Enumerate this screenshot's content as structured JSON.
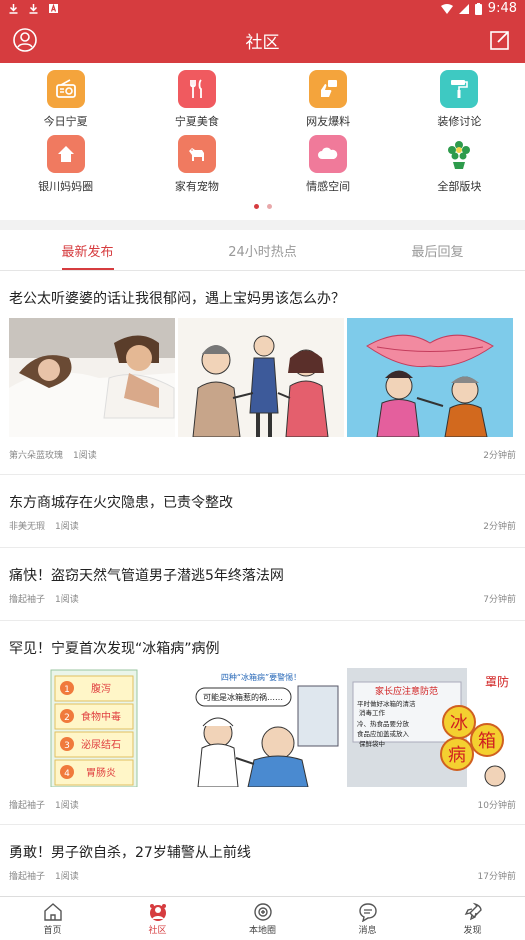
{
  "status": {
    "time": "9:48"
  },
  "header": {
    "title": "社区"
  },
  "categories": [
    {
      "label": "今日宁夏",
      "icon": "radio-icon",
      "color": "#f4a43c"
    },
    {
      "label": "宁夏美食",
      "icon": "cutlery-icon",
      "color": "#f05a5f"
    },
    {
      "label": "网友爆料",
      "icon": "thumbs-up-icon",
      "color": "#f4a43c"
    },
    {
      "label": "装修讨论",
      "icon": "paint-roller-icon",
      "color": "#3ec9c2"
    },
    {
      "label": "银川妈妈圈",
      "icon": "house-icon",
      "color": "#f07a60"
    },
    {
      "label": "家有宠物",
      "icon": "dog-icon",
      "color": "#f07a60"
    },
    {
      "label": "情感空间",
      "icon": "cloud-icon",
      "color": "#f07a9a"
    },
    {
      "label": "全部版块",
      "icon": "flower-icon",
      "color": "#ffffff"
    }
  ],
  "tabs": [
    {
      "label": "最新发布"
    },
    {
      "label": "24小时热点"
    },
    {
      "label": "最后回复"
    }
  ],
  "posts": [
    {
      "title": "老公太听婆婆的话让我很郁闷，遇上宝妈男该怎么办？",
      "author": "第六朵蓝玫瑰",
      "reads": "1阅读",
      "time": "2分钟前"
    },
    {
      "title": "东方商城存在火灾隐患，已责令整改",
      "author": "非美无瑕",
      "reads": "1阅读",
      "time": "2分钟前"
    },
    {
      "title": "痛快！盗窃天然气管道男子潜逃5年终落法网",
      "author": "撸起袖子",
      "reads": "1阅读",
      "time": "7分钟前"
    },
    {
      "title": "罕见！宁夏首次发现“冰箱病”病例",
      "author": "撸起袖子",
      "reads": "1阅读",
      "time": "10分钟前"
    },
    {
      "title": "勇敢！男子欲自杀，27岁辅警从上前线",
      "author": "撸起袖子",
      "reads": "1阅读",
      "time": "17分钟前"
    }
  ],
  "images": {
    "fridge_labels": [
      "腹泻",
      "食物中毒",
      "泌尿结石",
      "胃肠炎"
    ],
    "cartoon_header": "四种“冰箱病”要警惕！",
    "cartoon_bubble": "可能是冰箱惹的祸……",
    "poster_title": "家长应注意防范",
    "poster_lines": [
      "平时做好冰箱的清洁",
      "消毒工作",
      "冷、热食品要分放",
      "食品应加盖或放入",
      "保鲜袋中"
    ],
    "poster_big": [
      "冰",
      "箱",
      "病"
    ],
    "poster_side": "罩防"
  },
  "bottomnav": [
    {
      "label": "首页",
      "icon": "home-icon"
    },
    {
      "label": "社区",
      "icon": "community-icon"
    },
    {
      "label": "本地圈",
      "icon": "local-circle-icon"
    },
    {
      "label": "消息",
      "icon": "message-icon"
    },
    {
      "label": "发现",
      "icon": "discover-icon"
    }
  ]
}
